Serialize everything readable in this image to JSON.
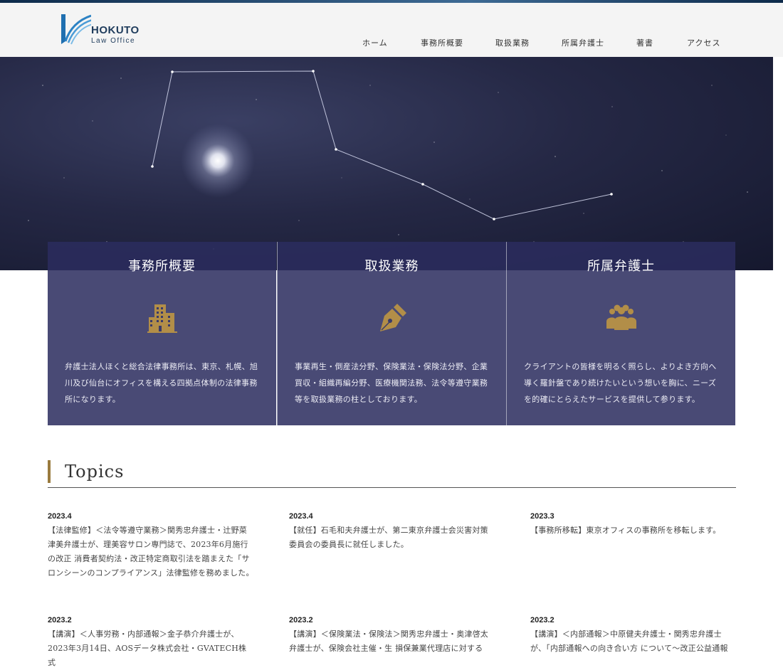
{
  "header": {
    "logo": {
      "name": "HOKUTO",
      "sub": "Law Office"
    },
    "nav": [
      "ホーム",
      "事務所概要",
      "取扱業務",
      "所属弁護士",
      "著書",
      "アクセス"
    ]
  },
  "cards": [
    {
      "title": "事務所概要",
      "icon": "building-icon",
      "text": "弁護士法人ほくと総合法律事務所は、東京、札幌、旭川及び仙台にオフィスを構える四拠点体制の法律事務所になります。"
    },
    {
      "title": "取扱業務",
      "icon": "pen-nib-icon",
      "text": "事業再生・倒産法分野、保険業法・保険法分野、企業買収・組織再編分野、医療機関法務、法令等遵守業務等を取扱業務の柱としております。"
    },
    {
      "title": "所属弁護士",
      "icon": "people-group-icon",
      "text": "クライアントの皆様を明るく照らし、よりよき方向へ導く羅針盤であり続けたいという想いを胸に、ニーズを的確にとらえたサービスを提供して参ります。"
    }
  ],
  "topics": {
    "title": "Topics",
    "items": [
      {
        "date": "2023.4",
        "text": "【法律監修】＜法令等遵守業務＞関秀忠弁護士・辻野菜津美弁護士が、理美容サロン専門誌で、2023年6月施行の改正 消費者契約法・改正特定商取引法を踏まえた「サロンシーンのコンプライアンス」法律監修を務めました。"
      },
      {
        "date": "2023.4",
        "text": "【就任】石毛和夫弁護士が、第二東京弁護士会災害対策委員会の委員長に就任しました。"
      },
      {
        "date": "2023.3",
        "text": "【事務所移転】東京オフィスの事務所を移転します。"
      },
      {
        "date": "2023.2",
        "text": "【講演】＜人事労務・内部通報＞金子恭介弁護士が、2023年3月14日、AOSデータ株式会社・GVATECH株式"
      },
      {
        "date": "2023.2",
        "text": "【講演】＜保険業法・保険法＞関秀忠弁護士・奥津啓太弁護士が、保険会社主催・生 損保兼業代理店に対する"
      },
      {
        "date": "2023.2",
        "text": "【講演】＜内部通報＞中原健夫弁護士・関秀忠弁護士が、「内部通報への向き合い方 について〜改正公益通報"
      }
    ]
  }
}
